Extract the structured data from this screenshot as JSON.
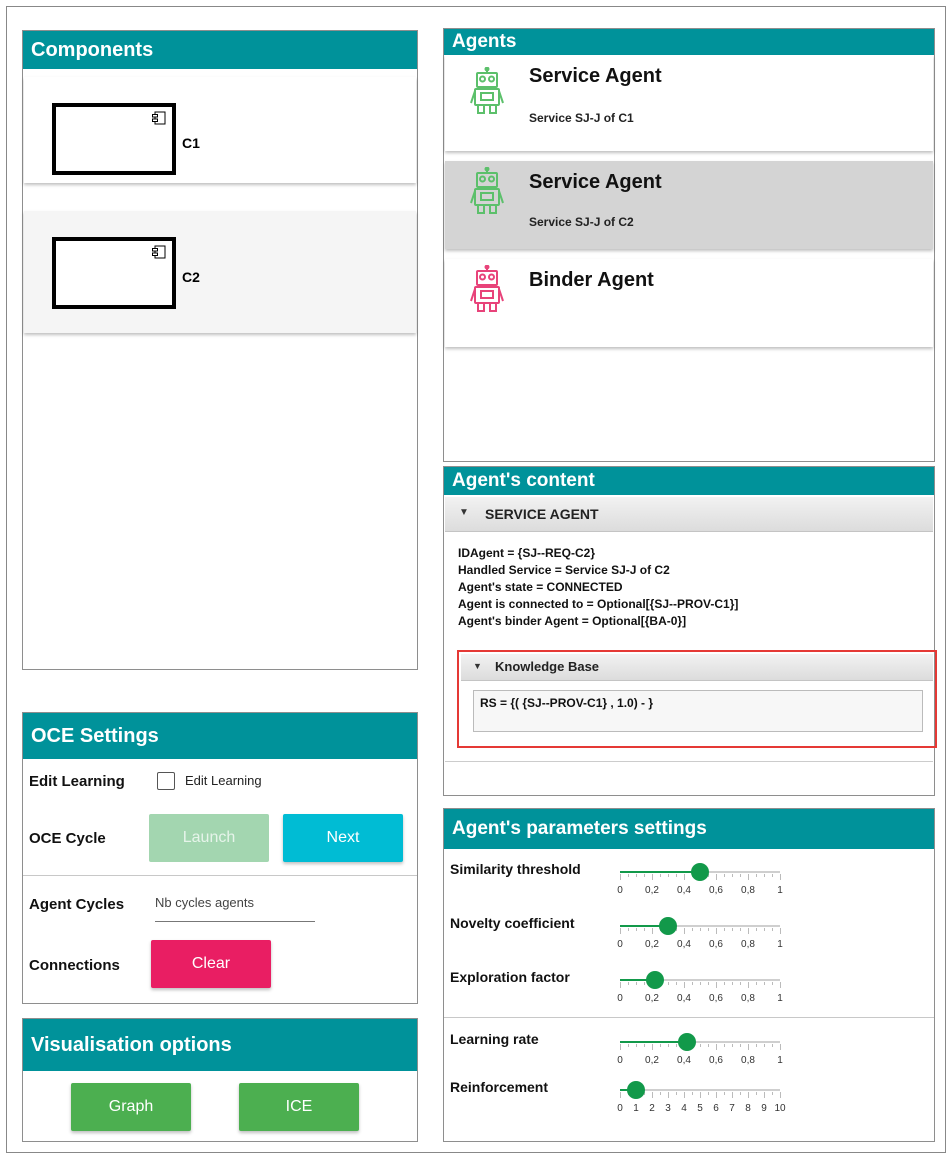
{
  "components": {
    "title": "Components",
    "items": [
      {
        "label": "C1"
      },
      {
        "label": "C2"
      }
    ]
  },
  "agents": {
    "title": "Agents",
    "items": [
      {
        "title": "Service Agent",
        "subtitle": "Service SJ-J of C1",
        "color": "#5cc06b",
        "selected": false
      },
      {
        "title": "Service Agent",
        "subtitle": "Service SJ-J of C2",
        "color": "#5cc06b",
        "selected": true
      },
      {
        "title": "Binder Agent",
        "subtitle": "",
        "color": "#e8437a",
        "selected": false
      }
    ]
  },
  "agent_content": {
    "title": "Agent's content",
    "section": "SERVICE AGENT",
    "lines": [
      "IDAgent = {SJ--REQ-C2}",
      "Handled Service  = Service SJ-J of C2",
      "Agent's state  = CONNECTED",
      "Agent is connected to  = Optional[{SJ--PROV-C1}]",
      "Agent's binder Agent  = Optional[{BA-0}]"
    ],
    "kb_title": "Knowledge Base",
    "kb_value": "RS = {( {SJ--PROV-C1} , 1.0) -  }"
  },
  "oce_settings": {
    "title": "OCE Settings",
    "edit_learning_label": "Edit Learning",
    "edit_learning_checkbox": "Edit Learning",
    "oce_cycle_label": "OCE Cycle",
    "launch": "Launch",
    "next": "Next",
    "agent_cycles_label": "Agent Cycles",
    "agent_cycles_placeholder": "Nb cycles agents",
    "connections_label": "Connections",
    "clear": "Clear"
  },
  "visualisation": {
    "title": "Visualisation options",
    "graph": "Graph",
    "ice": "ICE"
  },
  "params": {
    "title": "Agent's parameters settings",
    "sliders": [
      {
        "label": "Similarity threshold",
        "value": 0.5,
        "min": 0,
        "max": 1,
        "ticks": [
          "0",
          "0,2",
          "0,4",
          "0,6",
          "0,8",
          "1"
        ]
      },
      {
        "label": "Novelty coefficient",
        "value": 0.3,
        "min": 0,
        "max": 1,
        "ticks": [
          "0",
          "0,2",
          "0,4",
          "0,6",
          "0,8",
          "1"
        ]
      },
      {
        "label": "Exploration factor",
        "value": 0.22,
        "min": 0,
        "max": 1,
        "ticks": [
          "0",
          "0,2",
          "0,4",
          "0,6",
          "0,8",
          "1"
        ]
      },
      {
        "label": "Learning rate",
        "value": 0.42,
        "min": 0,
        "max": 1,
        "ticks": [
          "0",
          "0,2",
          "0,4",
          "0,6",
          "0,8",
          "1"
        ]
      },
      {
        "label": "Reinforcement",
        "value": 1,
        "min": 0,
        "max": 10,
        "ticks": [
          "0",
          "1",
          "2",
          "3",
          "4",
          "5",
          "6",
          "7",
          "8",
          "9",
          "10"
        ]
      }
    ]
  },
  "colors": {
    "header": "#00929a",
    "launch": "#a3d6b0",
    "next": "#00bcd4",
    "clear": "#e91e63",
    "green_button": "#4caf50",
    "slider": "#12994a",
    "kb_highlight": "#e53935"
  }
}
